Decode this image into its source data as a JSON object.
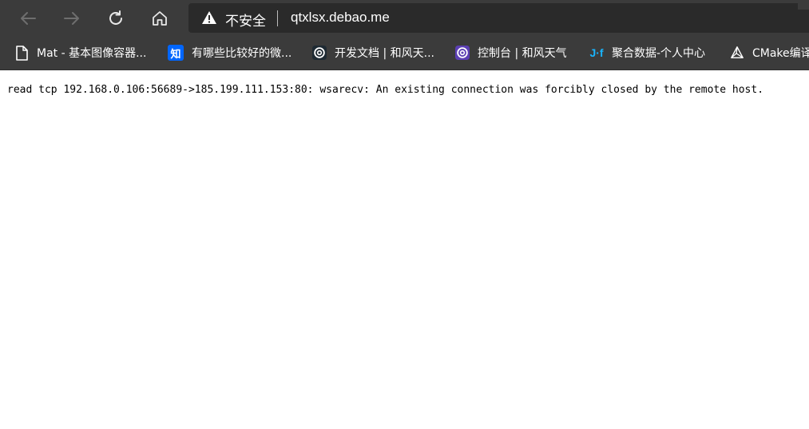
{
  "address_bar": {
    "security_label": "不安全",
    "url": "qtxlsx.debao.me"
  },
  "bookmarks": [
    {
      "label": "Mat - 基本图像容器...",
      "icon": "page-icon"
    },
    {
      "label": "有哪些比较好的微...",
      "icon": "zhihu-icon",
      "icon_text": "知"
    },
    {
      "label": "开发文档 | 和风天...",
      "icon": "qweather-icon"
    },
    {
      "label": "控制台 | 和风天气",
      "icon": "qweather-console-icon"
    },
    {
      "label": "聚合数据-个人中心",
      "icon": "juhe-icon",
      "icon_text": "J·f"
    },
    {
      "label": "CMake编译",
      "icon": "cmake-icon"
    }
  ],
  "page": {
    "error_text": "read tcp 192.168.0.106:56689->185.199.111.153:80: wsarecv: An existing connection was forcibly closed by the remote host."
  },
  "colors": {
    "toolbar": "#3b3b3b",
    "address_field": "#2a2a2a",
    "zhihu_blue": "#0066ff",
    "juhe_cyan": "#19b5fe",
    "qweather_purple": "#5b3fb3"
  }
}
